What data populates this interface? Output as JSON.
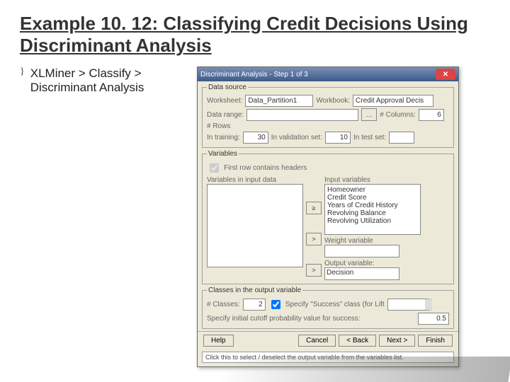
{
  "title": "Example 10. 12: Classifying Credit Decisions Using Discriminant Analysis",
  "bullet": "XLMiner > Classify > Discriminant Analysis",
  "dialog": {
    "title": "Discriminant Analysis - Step 1 of 3",
    "ds_legend": "Data source",
    "ws_lbl": "Worksheet:",
    "ws_val": "Data_Partition1",
    "wb_lbl": "Workbook:",
    "wb_val": "Credit Approval Decis",
    "range_lbl": "Data range:",
    "range_val": "",
    "cols_lbl": "# Columns:",
    "cols_val": "6",
    "rows_lbl": "# Rows",
    "train_lbl": "In training:",
    "train_val": "30",
    "valid_lbl": "In validation set:",
    "valid_val": "10",
    "test_lbl": "In test set:",
    "test_val": "",
    "vars_legend": "Variables",
    "firstrow_lbl": "First row contains headers",
    "left_lbl": "Variables in input data",
    "right_lbl": "Input variables",
    "inputs": [
      "Homeowner",
      "Credit Score",
      "Years of Credit History",
      "Revolving Balance",
      "Revolving Utilization"
    ],
    "weight_lbl": "Weight variable",
    "output_lbl": "Output variable:",
    "output_val": "Decision",
    "classes_legend": "Classes in the output variable",
    "nclasses_lbl": "# Classes:",
    "nclasses_val": "2",
    "success_lbl": "Specify \"Success\" class (for Lift",
    "cutoff_lbl": "Specify initial cutoff probability value for success:",
    "cutoff_val": "0.5",
    "help": "Help",
    "cancel": "Cancel",
    "back": "< Back",
    "next": "Next >",
    "finish": "Finish",
    "status": "Click this to select / deselect the output variable from the variables list."
  }
}
